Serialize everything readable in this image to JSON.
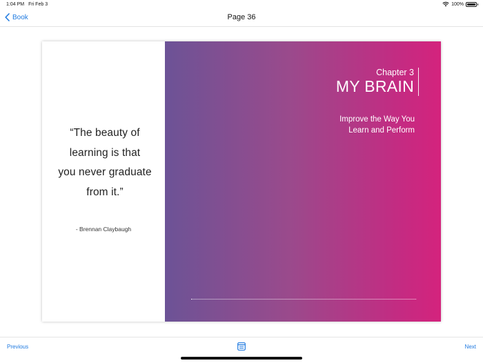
{
  "status_bar": {
    "time": "1:04 PM",
    "date": "Fri Feb 3",
    "battery": "100%",
    "icons": [
      "wifi-icon",
      "battery-icon"
    ]
  },
  "nav": {
    "back_label": "Book",
    "back_icon": "chevron-left-icon",
    "title": "Page 36"
  },
  "left_page": {
    "quote_lines": [
      "“The beauty of",
      "learning is that",
      "you never graduate",
      "from it.”"
    ],
    "author": "- Brennan Claybaugh"
  },
  "right_page": {
    "chapter_number": "Chapter 3",
    "chapter_title": "MY BRAIN",
    "subtitle_lines": [
      "Improve the Way You",
      "Learn and Perform"
    ],
    "gradient_colors": [
      "#6c5396",
      "#d4237d"
    ]
  },
  "bottom_bar": {
    "previous_label": "Previous",
    "next_label": "Next",
    "toc_icon": "table-of-contents-icon"
  },
  "colors": {
    "accent": "#1f7ae0"
  }
}
